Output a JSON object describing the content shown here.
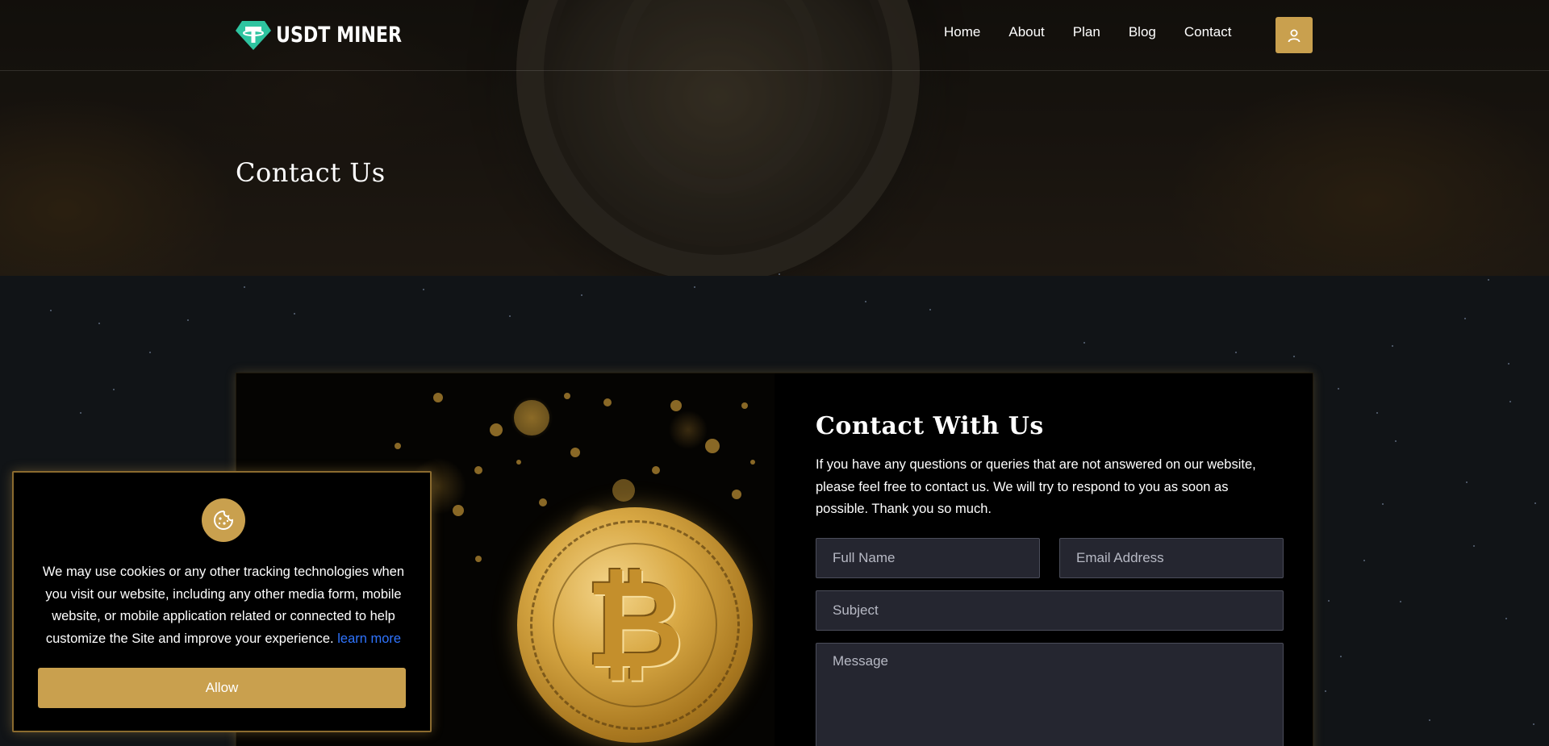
{
  "brand": {
    "name": "USDT MINER",
    "accent": "#c9a04e",
    "logo_color": "#2ec4a0"
  },
  "nav": {
    "items": [
      {
        "label": "Home"
      },
      {
        "label": "About"
      },
      {
        "label": "Plan"
      },
      {
        "label": "Blog"
      },
      {
        "label": "Contact"
      }
    ],
    "user_icon": "user-icon"
  },
  "hero": {
    "title": "Contact Us"
  },
  "contact": {
    "title": "Contact With Us",
    "description": "If you have any questions or queries that are not answered on our website, please feel free to contact us. We will try to respond to you as soon as possible. Thank you so much.",
    "fields": {
      "name_placeholder": "Full Name",
      "email_placeholder": "Email Address",
      "subject_placeholder": "Subject",
      "message_placeholder": "Message"
    }
  },
  "cookie": {
    "icon": "cookie-icon",
    "text": "We may use cookies or any other tracking technologies when you visit our website, including any other media form, mobile website, or mobile application related or connected to help customize the Site and improve your experience.",
    "link_label": "learn more",
    "allow_label": "Allow"
  }
}
